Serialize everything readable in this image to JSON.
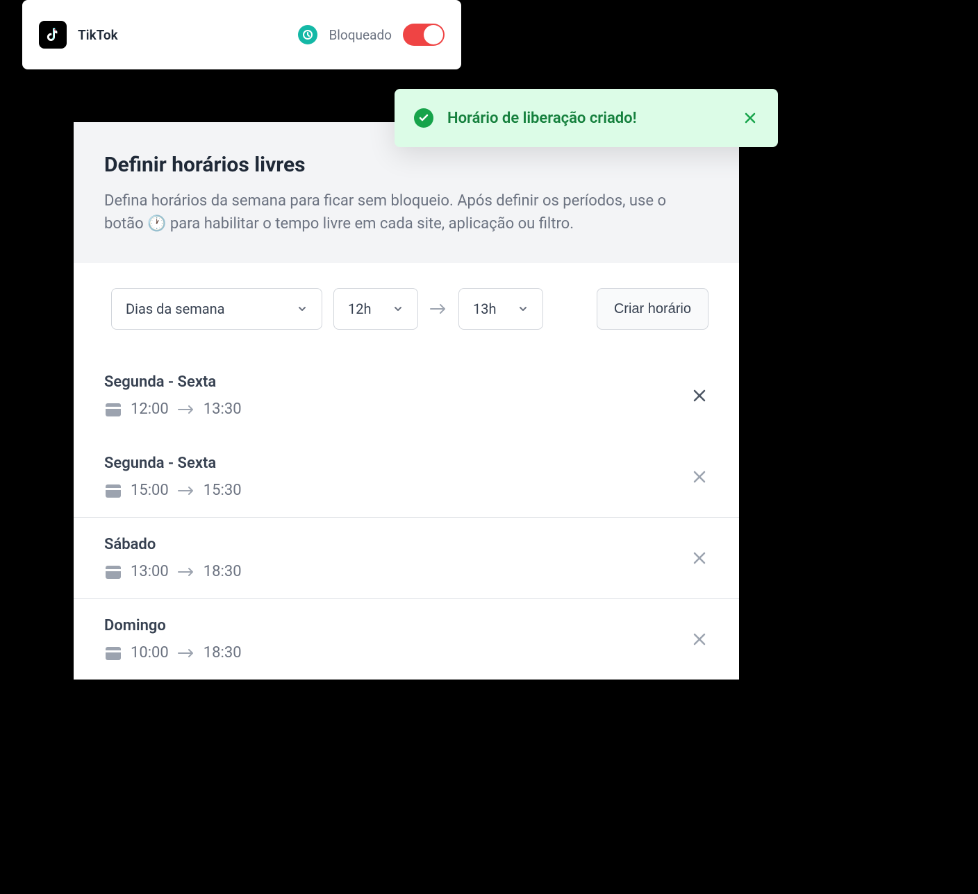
{
  "app_card": {
    "name": "TikTok",
    "blocked_label": "Bloqueado"
  },
  "toast": {
    "message": "Horário de liberação criado!"
  },
  "panel": {
    "title": "Definir horários livres",
    "subtitle": "Defina horários da semana para ficar sem bloqueio. Após definir os períodos, use o botão 🕐 para habilitar o tempo livre em cada site, aplicação ou filtro."
  },
  "controls": {
    "days_label": "Dias da semana",
    "start_hour": "12h",
    "end_hour": "13h",
    "create_label": "Criar horário"
  },
  "schedules": [
    {
      "days": "Segunda - Sexta",
      "start": "12:00",
      "end": "13:30",
      "bordered": false,
      "deleteDark": true
    },
    {
      "days": "Segunda - Sexta",
      "start": "15:00",
      "end": "15:30",
      "bordered": false,
      "deleteDark": false
    },
    {
      "days": "Sábado",
      "start": "13:00",
      "end": "18:30",
      "bordered": true,
      "deleteDark": false
    },
    {
      "days": "Domingo",
      "start": "10:00",
      "end": "18:30",
      "bordered": true,
      "deleteDark": false
    }
  ]
}
